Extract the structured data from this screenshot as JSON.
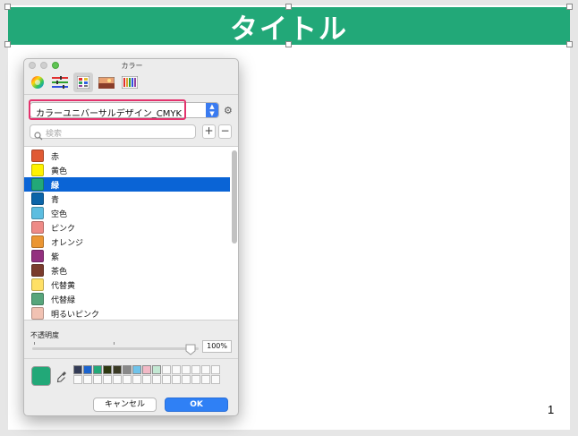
{
  "slide": {
    "title": "タイトル",
    "page_number": "1"
  },
  "color_panel": {
    "title": "カラー",
    "palette_name": "カラーユニバーサルデザイン_CMYK",
    "search_placeholder": "検索",
    "add_label": "+",
    "remove_label": "−",
    "colors": [
      {
        "name": "赤",
        "color": "#e05a34"
      },
      {
        "name": "黄色",
        "color": "#fff200"
      },
      {
        "name": "緑",
        "color": "#22a878"
      },
      {
        "name": "青",
        "color": "#0b64a8"
      },
      {
        "name": "空色",
        "color": "#5cbde0"
      },
      {
        "name": "ピンク",
        "color": "#ee8a86"
      },
      {
        "name": "オレンジ",
        "color": "#eb9633"
      },
      {
        "name": "紫",
        "color": "#93307f"
      },
      {
        "name": "茶色",
        "color": "#7a3b2c"
      },
      {
        "name": "代替黄",
        "color": "#ffe066"
      },
      {
        "name": "代替緑",
        "color": "#57a57b"
      },
      {
        "name": "明るいピンク",
        "color": "#f1c2b3"
      },
      {
        "name": "",
        "color": "#fff7cf"
      }
    ],
    "selected_index": 2,
    "opacity_label": "不透明度",
    "opacity_value": "100%",
    "opacity_fraction": 1.0,
    "current_color": "#22a878",
    "saved_wells": [
      "#333b56",
      "#1a63cf",
      "#22a878",
      "#2e3810",
      "#3a3a24",
      "#888888",
      "#6fc3ea",
      "#f2b9c6",
      "#c3e8d3"
    ],
    "cancel_label": "キャンセル",
    "ok_label": "OK"
  }
}
